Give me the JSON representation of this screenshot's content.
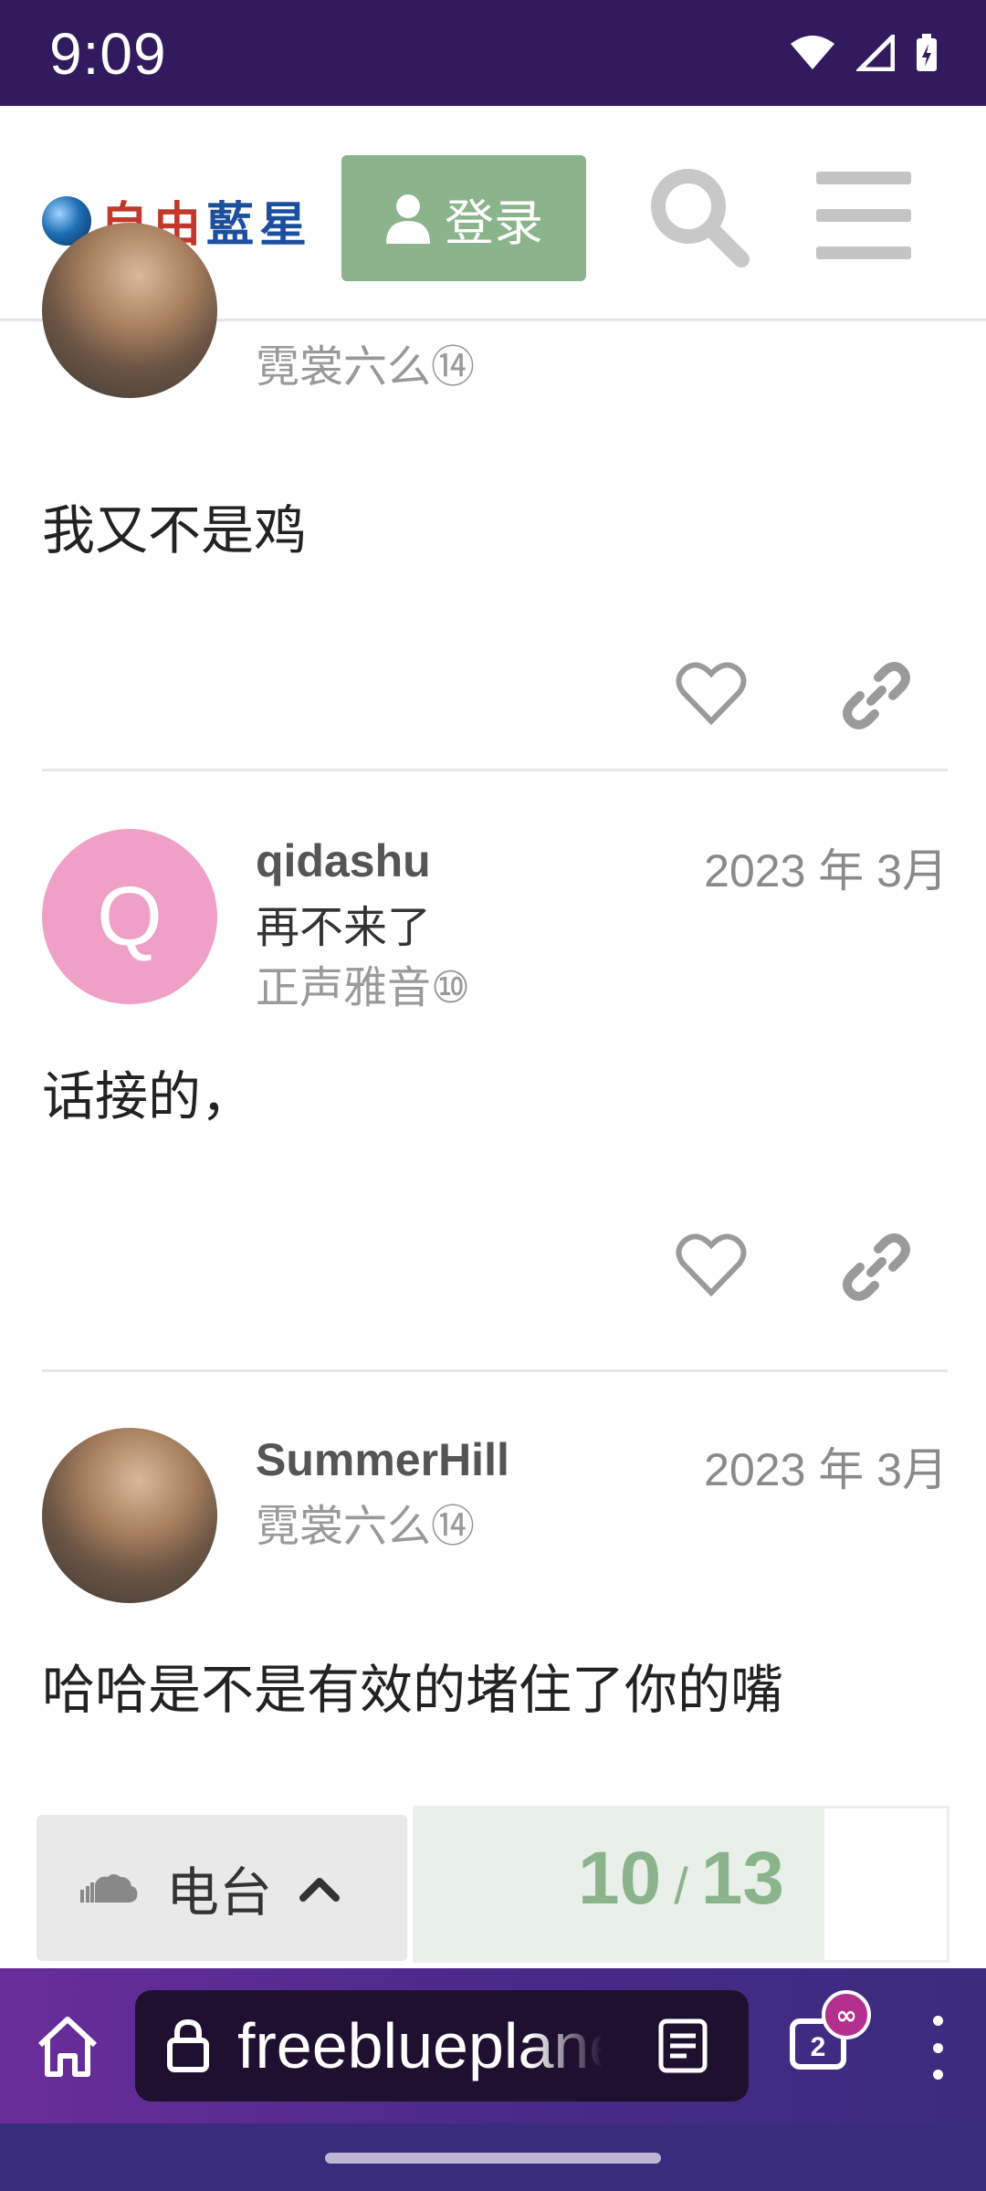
{
  "status_bar": {
    "time": "9:09"
  },
  "header": {
    "logo_text_red": "自由",
    "logo_text_blue": "藍星",
    "login_label": "登录"
  },
  "posts": [
    {
      "username": "",
      "user_group": "霓裳六么⑭",
      "body": "我又不是鸡"
    },
    {
      "avatar_letter": "Q",
      "username": "qidashu",
      "user_title": "再不来了",
      "user_group": "正声雅音⑩",
      "date": "2023 年 3月",
      "body": "话接的，"
    },
    {
      "username": "SummerHill",
      "user_group": "霓裳六么⑭",
      "date": "2023 年 3月",
      "body": "哈哈是不是有效的堵住了你的嘴"
    }
  ],
  "radio": {
    "label": "电台"
  },
  "progress": {
    "current": "10",
    "separator": "/",
    "total": "13",
    "fraction": 0.77
  },
  "browser": {
    "url": "freeblueplanet",
    "tab_count": "2"
  },
  "colors": {
    "accent_green": "#8bb38c",
    "status_bar": "#311b5e",
    "avatar_q": "#f0a0c6"
  }
}
